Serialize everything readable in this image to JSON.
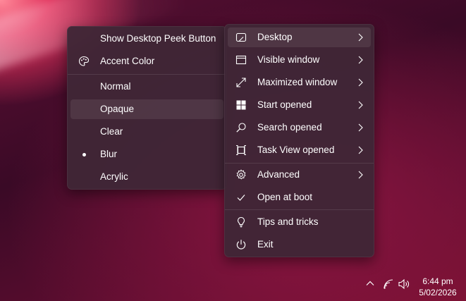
{
  "left_menu": {
    "show_desktop_peek": "Show Desktop Peek Button",
    "accent_color": "Accent Color",
    "modes": [
      "Normal",
      "Opaque",
      "Clear",
      "Blur",
      "Acrylic"
    ]
  },
  "right_menu": {
    "desktop": "Desktop",
    "visible_window": "Visible window",
    "maximized_window": "Maximized window",
    "start_opened": "Start opened",
    "search_opened": "Search opened",
    "task_view_opened": "Task View opened",
    "advanced": "Advanced",
    "open_at_boot": "Open at boot",
    "tips_and_tricks": "Tips and tricks",
    "exit": "Exit"
  },
  "taskbar": {
    "time": "6:44 pm",
    "date": "5/02/2026"
  },
  "state": {
    "highlighted_left": "Opaque",
    "highlighted_right": "Desktop",
    "selected_mode": "Blur",
    "open_at_boot_checked": true
  },
  "colors": {
    "menu_bg": "#402636",
    "accent_wallpaper": "#e0305a"
  }
}
